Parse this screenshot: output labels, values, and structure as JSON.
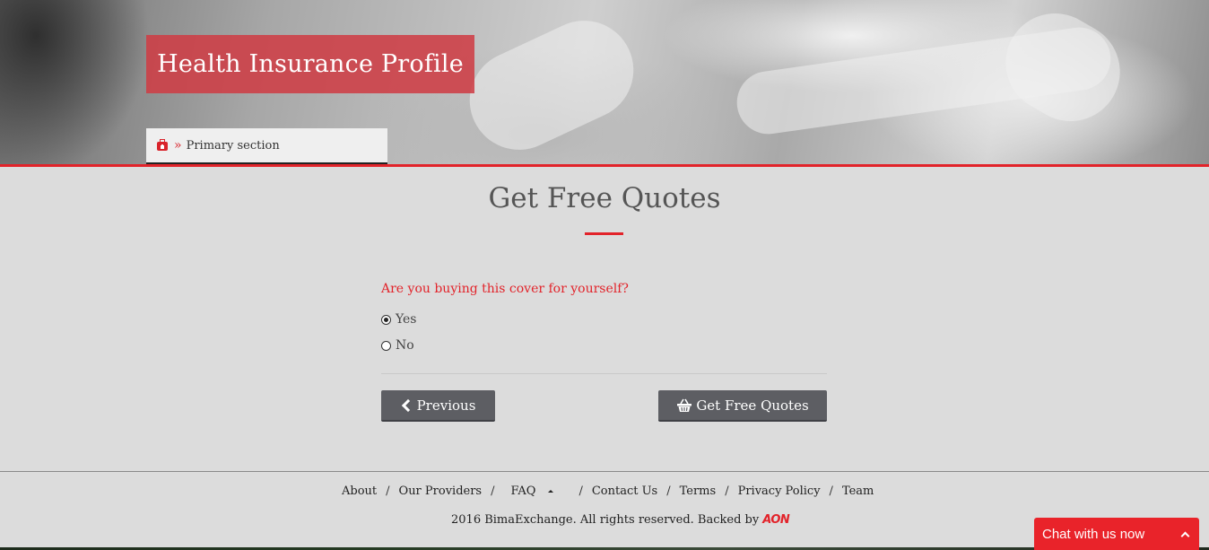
{
  "hero": {
    "title": "Health Insurance Profile",
    "breadcrumb": {
      "home_icon": "medkit-icon",
      "separator": "»",
      "current": "Primary section"
    }
  },
  "form": {
    "heading": "Get Free Quotes",
    "question": "Are you buying this cover for yourself?",
    "options": [
      {
        "label": "Yes",
        "selected": true
      },
      {
        "label": "No",
        "selected": false
      }
    ],
    "previous_label": "Previous",
    "previous_icon": "chevron-left-icon",
    "submit_label": "Get Free Quotes",
    "submit_icon": "basket-icon"
  },
  "footer": {
    "links": [
      "About",
      "Our Providers",
      "FAQ",
      "Contact Us",
      "Terms",
      "Privacy Policy",
      "Team"
    ],
    "separator": "/",
    "copyright": "2016 BimaExchange. All rights reserved. Backed by",
    "backer_logo": "AON"
  },
  "chat": {
    "label": "Chat with us now",
    "icon": "chevron-up-icon"
  },
  "colors": {
    "accent": "#e2232a",
    "button": "#5d5e63",
    "title_box": "#ce3e46",
    "background": "#dcdcdc"
  }
}
